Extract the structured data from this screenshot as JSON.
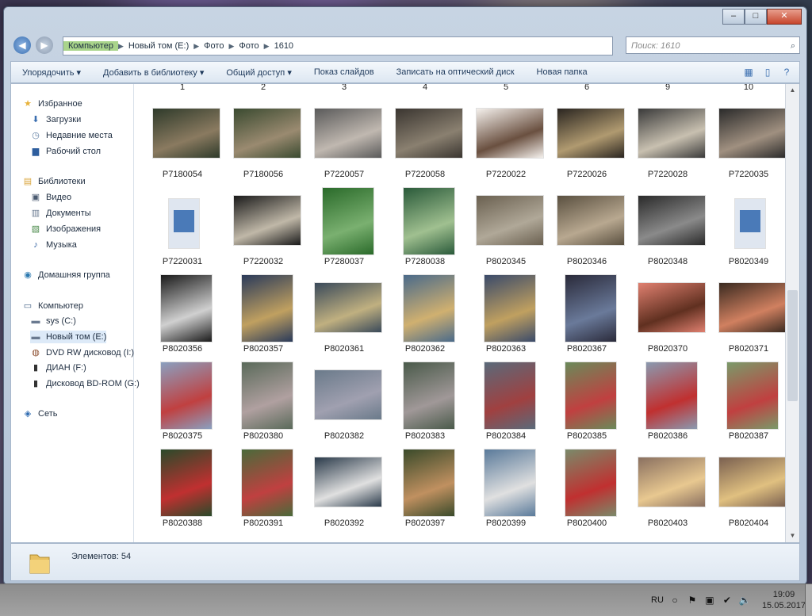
{
  "window": {
    "caption_buttons": {
      "minimize": "–",
      "maximize": "□",
      "close": "✕"
    },
    "nav": {
      "back_glyph": "◀",
      "forward_glyph": "▶"
    },
    "address": [
      "Компьютер",
      "Новый том (E:)",
      "Фото",
      "Фото",
      "1610"
    ],
    "search_placeholder": "Поиск: 1610"
  },
  "toolbar": {
    "items": [
      "Упорядочить ▾",
      "Добавить в библиотеку ▾",
      "Общий доступ ▾",
      "Показ слайдов",
      "Записать на оптический диск",
      "Новая папка"
    ]
  },
  "sidebar": {
    "items": [
      {
        "label": "Избранное",
        "icon": "star-icon",
        "glyph": "★",
        "color": "#e8b23a"
      },
      {
        "label": "Загрузки",
        "icon": "downloads-icon",
        "glyph": "⬇",
        "color": "#3b6fb0"
      },
      {
        "label": "Недавние места",
        "icon": "recent-places-icon",
        "glyph": "◷",
        "color": "#5a7aa0"
      },
      {
        "label": "Рабочий стол",
        "icon": "desktop-icon",
        "glyph": "▆",
        "color": "#2e5e9e"
      },
      {
        "label": "Библиотеки",
        "icon": "libraries-icon",
        "glyph": "▤",
        "color": "#d9a43a"
      },
      {
        "label": "Видео",
        "icon": "video-icon",
        "glyph": "▣",
        "color": "#4a5a70"
      },
      {
        "label": "Документы",
        "icon": "documents-icon",
        "glyph": "▥",
        "color": "#6a7a90"
      },
      {
        "label": "Изображения",
        "icon": "pictures-icon",
        "glyph": "▧",
        "color": "#4a8a4a"
      },
      {
        "label": "Музыка",
        "icon": "music-icon",
        "glyph": "♪",
        "color": "#2e5e9e"
      },
      {
        "label": "Домашняя группа",
        "icon": "homegroup-icon",
        "glyph": "◉",
        "color": "#2e7ab0"
      },
      {
        "label": "Компьютер",
        "icon": "computer-icon",
        "glyph": "▭",
        "color": "#3b5a80"
      },
      {
        "label": "sys (C:)",
        "icon": "drive-icon",
        "glyph": "▬",
        "color": "#6a7a90"
      },
      {
        "label": "Новый том (E:)",
        "icon": "drive-icon",
        "glyph": "▬",
        "color": "#6a7a90"
      },
      {
        "label": "DVD RW дисковод (I:)",
        "icon": "dvd-drive-icon",
        "glyph": "◍",
        "color": "#8a4a2a"
      },
      {
        "label": "ДИАН (F:)",
        "icon": "removable-drive-icon",
        "glyph": "▮",
        "color": "#333"
      },
      {
        "label": "Дисковод BD-ROM (G:)",
        "icon": "bd-drive-icon",
        "glyph": "▮",
        "color": "#333"
      },
      {
        "label": "Сеть",
        "icon": "network-icon",
        "glyph": "◈",
        "color": "#2e6ab0"
      }
    ]
  },
  "files": [
    {
      "name": "1",
      "colors": [
        "#3a2a20",
        "#c9a08a"
      ]
    },
    {
      "name": "2",
      "colors": [
        "#6a5a40",
        "#d8c090"
      ]
    },
    {
      "name": "3",
      "colors": [
        "#503a30",
        "#b89070"
      ]
    },
    {
      "name": "4",
      "colors": [
        "#4a3020",
        "#a8806a"
      ]
    },
    {
      "name": "5",
      "colors": [
        "#c07060",
        "#f0d0c0"
      ]
    },
    {
      "name": "6",
      "colors": [
        "#7a3030",
        "#e0a090"
      ]
    },
    {
      "name": "9",
      "colors": [
        "#3a3a60",
        "#a0a0d0"
      ]
    },
    {
      "name": "10",
      "colors": [
        "#2a3a6a",
        "#b0b0e0"
      ]
    },
    {
      "name": "P7180054",
      "colors": [
        "#2e3a2a",
        "#8a7a60"
      ]
    },
    {
      "name": "P7180056",
      "colors": [
        "#3a4a30",
        "#9a8a70"
      ]
    },
    {
      "name": "P7220057",
      "colors": [
        "#5a5a5a",
        "#c0b8b0"
      ]
    },
    {
      "name": "P7220058",
      "colors": [
        "#3a3530",
        "#8a8070"
      ]
    },
    {
      "name": "P7220022",
      "colors": [
        "#f4f0ec",
        "#6a5040"
      ]
    },
    {
      "name": "P7220026",
      "colors": [
        "#2a2520",
        "#b09a70"
      ]
    },
    {
      "name": "P7220028",
      "colors": [
        "#3a3a3a",
        "#c8c0b0"
      ]
    },
    {
      "name": "P7220035",
      "colors": [
        "#2a2a2a",
        "#a09080"
      ]
    },
    {
      "name": "P7220031",
      "colors": [
        "#dfe6f0",
        "#4a7ab8"
      ],
      "doc": true
    },
    {
      "name": "P7220032",
      "colors": [
        "#1a1a1a",
        "#c0b8a8"
      ]
    },
    {
      "name": "P7280037",
      "colors": [
        "#2a6a2a",
        "#7ab070"
      ]
    },
    {
      "name": "P7280038",
      "colors": [
        "#2a5a3a",
        "#a0c090"
      ]
    },
    {
      "name": "P8020345",
      "colors": [
        "#6a6050",
        "#b0a898"
      ]
    },
    {
      "name": "P8020346",
      "colors": [
        "#5a5040",
        "#b8a890"
      ]
    },
    {
      "name": "P8020348",
      "colors": [
        "#2a2a2a",
        "#8a8a8a"
      ]
    },
    {
      "name": "P8020349",
      "colors": [
        "#dfe6f0",
        "#4a7ab8"
      ],
      "doc": true
    },
    {
      "name": "P8020356",
      "colors": [
        "#1a1a1a",
        "#d0d0d0"
      ]
    },
    {
      "name": "P8020357",
      "colors": [
        "#2a3a5a",
        "#c0a060"
      ]
    },
    {
      "name": "P8020361",
      "colors": [
        "#3a4a5a",
        "#c0b080"
      ]
    },
    {
      "name": "P8020362",
      "colors": [
        "#4a6a8a",
        "#d0b070"
      ]
    },
    {
      "name": "P8020363",
      "colors": [
        "#3a4a6a",
        "#c0a060"
      ]
    },
    {
      "name": "P8020367",
      "colors": [
        "#2a2a3a",
        "#6a7a9a"
      ]
    },
    {
      "name": "P8020370",
      "colors": [
        "#e08070",
        "#603020"
      ]
    },
    {
      "name": "P8020371",
      "colors": [
        "#3a2a20",
        "#d08060"
      ]
    },
    {
      "name": "P8020375",
      "colors": [
        "#8aa0c0",
        "#c04040"
      ]
    },
    {
      "name": "P8020380",
      "colors": [
        "#5a6a5a",
        "#b0a0a0"
      ]
    },
    {
      "name": "P8020382",
      "colors": [
        "#6a7a8a",
        "#a0a0b0"
      ]
    },
    {
      "name": "P8020383",
      "colors": [
        "#4a5a4a",
        "#a09898"
      ]
    },
    {
      "name": "P8020384",
      "colors": [
        "#5a6a7a",
        "#a04040"
      ]
    },
    {
      "name": "P8020385",
      "colors": [
        "#6a8a5a",
        "#c04040"
      ]
    },
    {
      "name": "P8020386",
      "colors": [
        "#8a9ab0",
        "#c03030"
      ]
    },
    {
      "name": "P8020387",
      "colors": [
        "#7a9a6a",
        "#c04040"
      ]
    },
    {
      "name": "P8020388",
      "colors": [
        "#2a4a2a",
        "#c03030"
      ]
    },
    {
      "name": "P8020391",
      "colors": [
        "#4a6a3a",
        "#c04040"
      ]
    },
    {
      "name": "P8020392",
      "colors": [
        "#2a3a4a",
        "#e0e0e0"
      ]
    },
    {
      "name": "P8020397",
      "colors": [
        "#3a4a2a",
        "#c09060"
      ]
    },
    {
      "name": "P8020399",
      "colors": [
        "#5a7a9a",
        "#e0e0e0"
      ]
    },
    {
      "name": "P8020400",
      "colors": [
        "#7a8a6a",
        "#c03030"
      ]
    },
    {
      "name": "P8020403",
      "colors": [
        "#8a7060",
        "#e8c890"
      ]
    },
    {
      "name": "P8020404",
      "colors": [
        "#7a6050",
        "#e0c080"
      ]
    }
  ],
  "status": {
    "text": "Элементов: 54"
  },
  "taskbar": {
    "lang": "RU",
    "time": "19:09",
    "date": "15.05.2017",
    "tray_icons": [
      {
        "name": "circle-icon",
        "glyph": "○"
      },
      {
        "name": "flag-icon",
        "glyph": "⚑"
      },
      {
        "name": "network-tray-icon",
        "glyph": "▣"
      },
      {
        "name": "check-icon",
        "glyph": "✔"
      },
      {
        "name": "volume-icon",
        "glyph": "🔈"
      }
    ]
  }
}
